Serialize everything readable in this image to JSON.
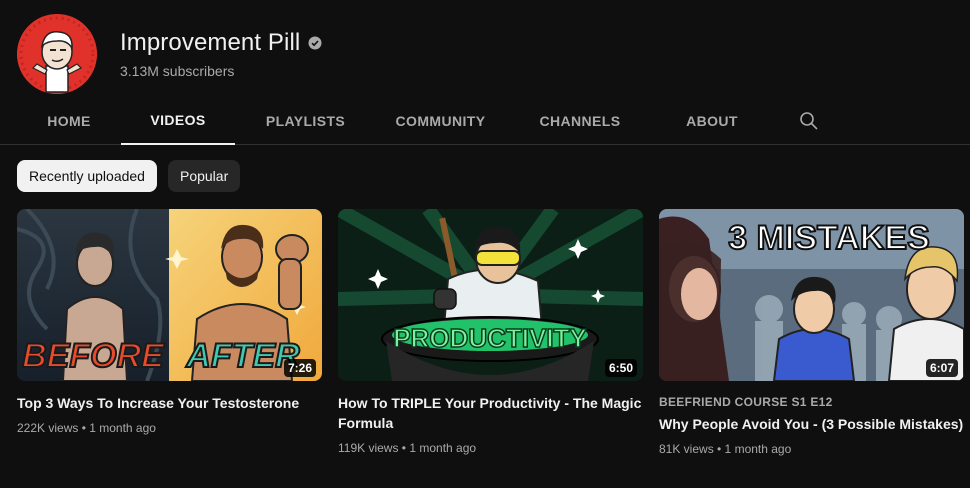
{
  "channel": {
    "name": "Improvement Pill",
    "subscribers": "3.13M subscribers"
  },
  "tabs": [
    {
      "label": "HOME",
      "active": false
    },
    {
      "label": "VIDEOS",
      "active": true
    },
    {
      "label": "PLAYLISTS",
      "active": false
    },
    {
      "label": "COMMUNITY",
      "active": false
    },
    {
      "label": "CHANNELS",
      "active": false
    },
    {
      "label": "ABOUT",
      "active": false
    }
  ],
  "chips": [
    {
      "label": "Recently uploaded",
      "selected": true
    },
    {
      "label": "Popular",
      "selected": false
    }
  ],
  "videos": [
    {
      "thumb_text_left": "BEFORE",
      "thumb_text_right": "AFTER",
      "duration": "7:26",
      "title": "Top 3 Ways To Increase Your Testosterone",
      "meta": "222K views • 1 month ago"
    },
    {
      "thumb_text": "PRODUCTIVITY",
      "duration": "6:50",
      "title": "How To TRIPLE Your Productivity - The Magic Formula",
      "meta": "119K views • 1 month ago"
    },
    {
      "thumb_text": "3 MISTAKES",
      "duration": "6:07",
      "series": "BEEFRIEND COURSE  S1 E12",
      "title": "Why People Avoid You - (3 Possible Mistakes)",
      "meta": "81K views • 1 month ago"
    }
  ],
  "colors": {
    "background": "#0f0f0f",
    "text_primary": "#f1f1f1",
    "text_secondary": "#aaaaaa",
    "chip": "#272727",
    "avatar": "#e0322a"
  },
  "icons": [
    "verified-badge-icon",
    "search-icon"
  ]
}
